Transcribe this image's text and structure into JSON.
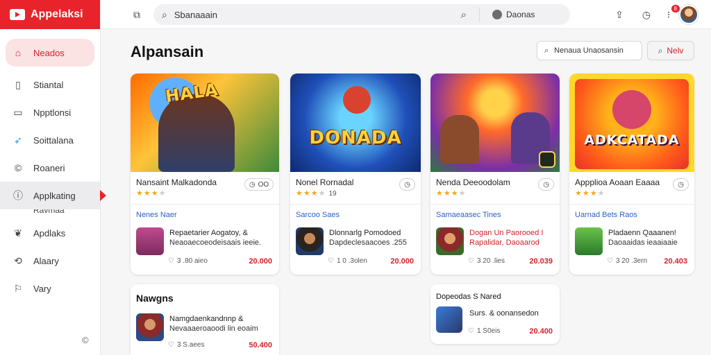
{
  "app": {
    "name": "Appelaksi"
  },
  "sidebar": {
    "items": [
      {
        "label": "Neados",
        "icon": "home-icon"
      },
      {
        "label": "Stiantal",
        "icon": "book-icon"
      },
      {
        "label": "Npptlonsi",
        "icon": "monitor-icon"
      },
      {
        "label": "Soittalana",
        "icon": "bird-icon"
      },
      {
        "label": "Roaneri",
        "icon": "circle-c-icon"
      },
      {
        "label": "Applkating",
        "icon": "info-icon"
      },
      {
        "label": "Apdlaks",
        "icon": "leaf-icon"
      },
      {
        "label": "Alaary",
        "icon": "sync-icon"
      },
      {
        "label": "Vary",
        "icon": "flag-icon"
      }
    ],
    "sub_label": "Ravmaa"
  },
  "topbar": {
    "search_value": "Sbanaaain",
    "scope_label": "Daonas",
    "notif_count": "8"
  },
  "main": {
    "title": "Alpansain",
    "filter_value": "Nenaua Unaosansin",
    "new_button": "Nelv"
  },
  "cards": [
    {
      "art_text": "HALA",
      "name": "Nansaint Malkadonda",
      "rating": 3,
      "count": "",
      "action_label": "OO",
      "section": "Nenes Naer",
      "item_line1": "Repaetarier Aogatoy, &",
      "item_line2": "Neaoaecoeodeisaais ieeie.",
      "meta": "3 .80 aieo",
      "price": "20.000"
    },
    {
      "art_text": "DONADA",
      "name": "Nonel Rornadal",
      "rating": 3,
      "count": "19",
      "action_label": "",
      "section": "Sarcoo Saes",
      "item_line1": "Dlonnarlg Pomodoed",
      "item_line2": "Dapdeclesaacoes .255",
      "meta": "1 0 .3olen",
      "price": "20.000"
    },
    {
      "art_text": "",
      "name": "Nenda Deeoodolam",
      "rating": 3,
      "count": "",
      "action_label": "",
      "section": "Samaeaasec Tines",
      "item_line1": "Dogan Un Paorooed I",
      "item_line2": "Rapalidar, Daoaarod",
      "meta": "3 20 .lies",
      "price": "20.039"
    },
    {
      "art_text": "ADKCATADA",
      "name": "Appplioa Aoaan Eaaaa",
      "rating": 3,
      "count": "",
      "action_label": "",
      "section": "Uarnad Bets Raos",
      "item_line1": "Pladaenn Qaaanen!",
      "item_line2": "Daoaaidas ieaaiaaie",
      "meta": "3 20 .3ern",
      "price": "20.403"
    }
  ],
  "bottom_cards": [
    {
      "title": "Nawgns",
      "item_line1": "Namgdaenkandnnp &",
      "item_line2": "Nevaaaeroaoodi lin eoaim",
      "meta": "3 S.aees",
      "price": "50.400"
    },
    {
      "title": "Dopeodas S Nared",
      "item_line1": "Surs. & oonansedon",
      "item_line2": "",
      "meta": "1 S0eis",
      "price": "20.400"
    }
  ]
}
